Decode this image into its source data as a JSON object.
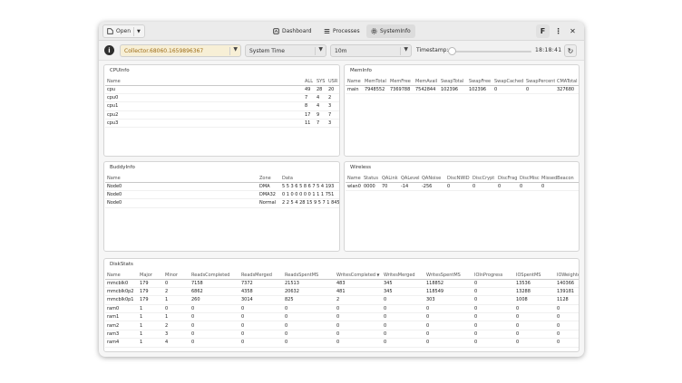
{
  "header": {
    "open_label": "Open",
    "tabs": [
      {
        "label": "Dashboard",
        "icon": "dashboard-icon"
      },
      {
        "label": "Processes",
        "icon": "list-icon"
      },
      {
        "label": "SystemInfo",
        "icon": "gear-icon"
      }
    ]
  },
  "toolbar": {
    "collector": "Collector.68060.1659896367",
    "time_mode": "System Time",
    "interval": "10m",
    "timestamp_label": "Timestamp:",
    "time_value": "18:18:41",
    "timestamp_position": 0
  },
  "cpuinfo": {
    "title": "CPUInfo",
    "columns": [
      "Name",
      "ALL",
      "SYS",
      "USR"
    ],
    "rows": [
      [
        "cpu",
        "49",
        "28",
        "20"
      ],
      [
        "cpu0",
        "7",
        "4",
        "2"
      ],
      [
        "cpu1",
        "8",
        "4",
        "3"
      ],
      [
        "cpu2",
        "17",
        "9",
        "7"
      ],
      [
        "cpu3",
        "11",
        "7",
        "3"
      ]
    ]
  },
  "meminfo": {
    "title": "MemInfo",
    "columns": [
      "Name",
      "MemTotal",
      "MemFree",
      "MemAvail",
      "SwapTotal",
      "SwapFree",
      "SwapCached",
      "SwapPercent",
      "CMATotal"
    ],
    "rows": [
      [
        "main",
        "7948552",
        "7369788",
        "7542844",
        "102396",
        "102396",
        "0",
        "0",
        "327680"
      ]
    ]
  },
  "buddyinfo": {
    "title": "BuddyInfo",
    "columns": [
      "Name",
      "Zone",
      "Data"
    ],
    "rows": [
      [
        "Node0",
        "DMA",
        "5 5 3 6 5 8 6 7 5 4 193"
      ],
      [
        "Node0",
        "DMA32",
        "0 1 0 0 0 0 0 1 1 1 751"
      ],
      [
        "Node0",
        "Normal",
        "2 2 5 4 28 15 9 5 7 1 845"
      ]
    ]
  },
  "wireless": {
    "title": "Wireless",
    "columns": [
      "Name",
      "Status",
      "QALink",
      "QALevel",
      "QANoise",
      "DiscNWID",
      "DiscCrypt",
      "DiscFrag",
      "DiscMisc",
      "MissedBeacon"
    ],
    "rows": [
      [
        "wlan0",
        "0000",
        "70",
        "-14",
        "-256",
        "0",
        "0",
        "0",
        "0",
        "0"
      ]
    ]
  },
  "diskstats": {
    "title": "DiskStats",
    "columns": [
      "Name",
      "Major",
      "Minor",
      "ReadsCompleted",
      "ReadsMerged",
      "ReadsSpentMS",
      "WritesCompleted",
      "WritesMerged",
      "WritesSpentMS",
      "IOInProgress",
      "IOSpentMS",
      "IOWeighted"
    ],
    "sort_indicator": "▼",
    "rows": [
      [
        "mmcblk0",
        "179",
        "0",
        "7158",
        "7372",
        "21513",
        "483",
        "345",
        "118852",
        "0",
        "13536",
        "140366"
      ],
      [
        "mmcblk0p2",
        "179",
        "2",
        "6862",
        "4358",
        "20632",
        "481",
        "345",
        "118549",
        "0",
        "13288",
        "139181"
      ],
      [
        "mmcblk0p1",
        "179",
        "1",
        "260",
        "3014",
        "825",
        "2",
        "0",
        "303",
        "0",
        "1008",
        "1128"
      ],
      [
        "ram0",
        "1",
        "0",
        "0",
        "0",
        "0",
        "0",
        "0",
        "0",
        "0",
        "0",
        "0"
      ],
      [
        "ram1",
        "1",
        "1",
        "0",
        "0",
        "0",
        "0",
        "0",
        "0",
        "0",
        "0",
        "0"
      ],
      [
        "ram2",
        "1",
        "2",
        "0",
        "0",
        "0",
        "0",
        "0",
        "0",
        "0",
        "0",
        "0"
      ],
      [
        "ram3",
        "1",
        "3",
        "0",
        "0",
        "0",
        "0",
        "0",
        "0",
        "0",
        "0",
        "0"
      ],
      [
        "ram4",
        "1",
        "4",
        "0",
        "0",
        "0",
        "0",
        "0",
        "0",
        "0",
        "0",
        "0"
      ]
    ]
  },
  "colors": {
    "accent": "#3584e4",
    "collector_text": "#9c6b15",
    "collector_bg": "#f7efd6"
  }
}
